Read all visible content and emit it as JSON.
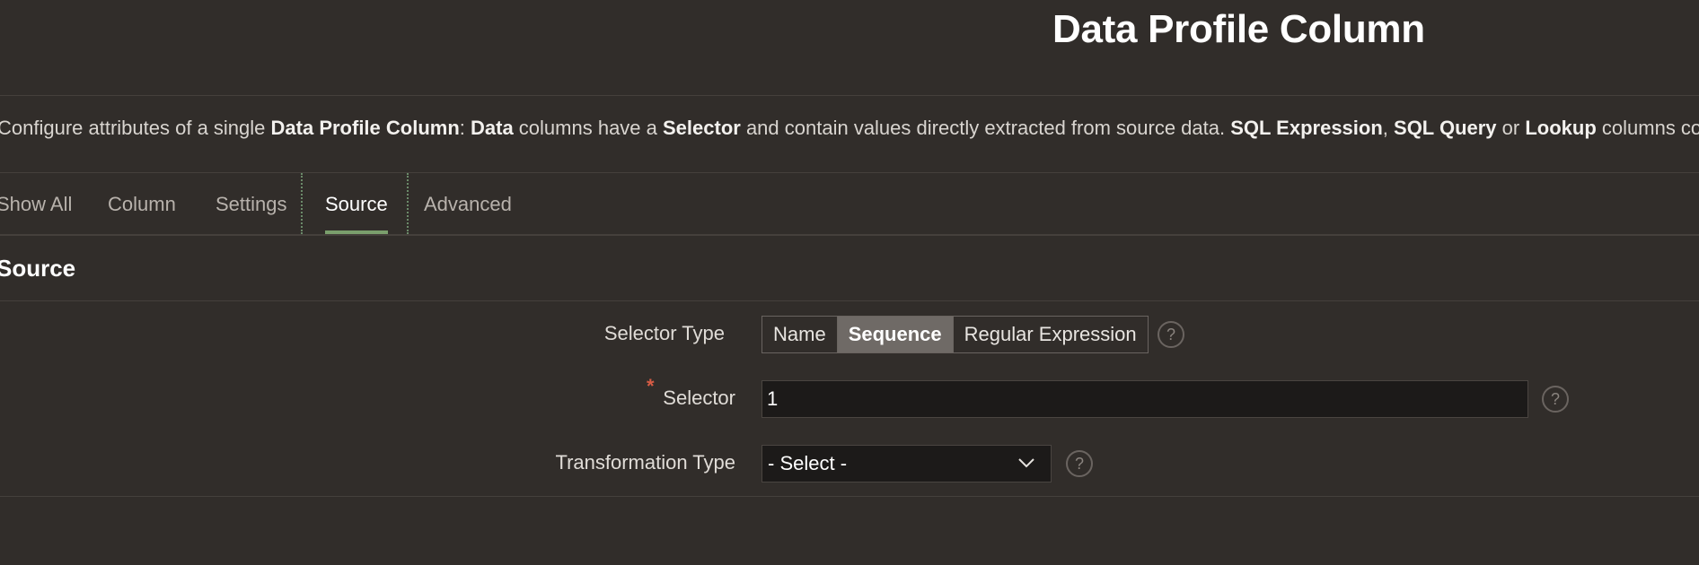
{
  "page": {
    "title": "Data Profile Column"
  },
  "description": {
    "segments": [
      {
        "text": "Configure attributes of a single ",
        "bold": false
      },
      {
        "text": "Data Profile Column",
        "bold": true
      },
      {
        "text": ": ",
        "bold": false
      },
      {
        "text": "Data",
        "bold": true
      },
      {
        "text": " columns have a ",
        "bold": false
      },
      {
        "text": "Selector",
        "bold": true
      },
      {
        "text": " and contain values directly extracted from source data. ",
        "bold": false
      },
      {
        "text": "SQL Expression",
        "bold": true
      },
      {
        "text": ", ",
        "bold": false
      },
      {
        "text": "SQL Query",
        "bold": true
      },
      {
        "text": " or ",
        "bold": false
      },
      {
        "text": "Lookup",
        "bold": true
      },
      {
        "text": " columns conta",
        "bold": false
      }
    ]
  },
  "tabs": {
    "show_all": "Show All",
    "column": "Column",
    "settings": "Settings",
    "source": "Source",
    "advanced": "Advanced",
    "active": "Source"
  },
  "region": {
    "title": "Source"
  },
  "form": {
    "selector_type": {
      "label": "Selector Type",
      "options": [
        "Name",
        "Sequence",
        "Regular Expression"
      ],
      "selected": "Sequence",
      "help": "?"
    },
    "selector": {
      "label": "Selector",
      "required_mark": "*",
      "value": "1",
      "help": "?"
    },
    "transformation_type": {
      "label": "Transformation Type",
      "value": "- Select -",
      "help": "?"
    }
  },
  "colors": {
    "background": "#312d2a",
    "tab_active_underline": "#7a9e6c",
    "required": "#d75c45",
    "input_background": "#1c1a19"
  },
  "icons": {
    "help": "help-circle-icon",
    "dropdown": "chevron-down-icon"
  }
}
